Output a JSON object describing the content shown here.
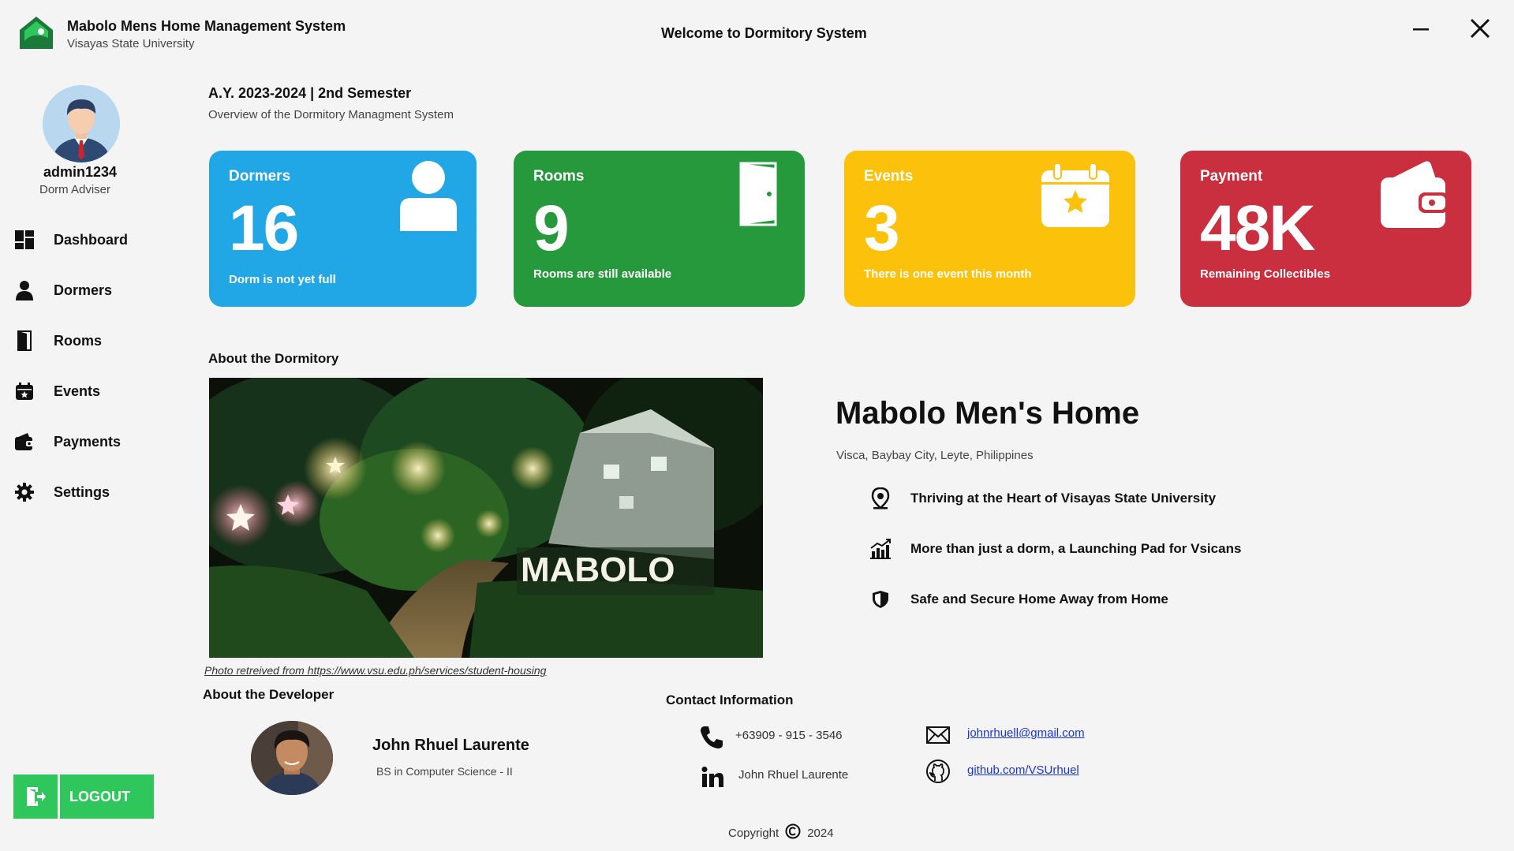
{
  "app": {
    "title": "Mabolo Mens Home Management System",
    "subtitle": "Visayas State University",
    "welcome": "Welcome to Dormitory System"
  },
  "user": {
    "name": "admin1234",
    "role": "Dorm Adviser"
  },
  "nav": [
    {
      "label": "Dashboard",
      "icon": "dashboard-icon"
    },
    {
      "label": "Dormers",
      "icon": "person-icon"
    },
    {
      "label": "Rooms",
      "icon": "door-icon"
    },
    {
      "label": "Events",
      "icon": "calendar-icon"
    },
    {
      "label": "Payments",
      "icon": "wallet-icon"
    },
    {
      "label": "Settings",
      "icon": "gear-icon"
    }
  ],
  "logout_label": "LOGOUT",
  "header": {
    "academic_year": "A.Y. 2023-2024 | 2nd Semester",
    "overview": "Overview of the Dormitory Managment System"
  },
  "cards": [
    {
      "title": "Dormers",
      "value": "16",
      "subtitle": "Dorm is not yet full",
      "color": "#21a7e5",
      "icon": "person-icon"
    },
    {
      "title": "Rooms",
      "value": "9",
      "subtitle": "Rooms are still available",
      "color": "#27993d",
      "icon": "door-icon"
    },
    {
      "title": "Events",
      "value": "3",
      "subtitle": "There is one event this month",
      "color": "#fcc10b",
      "icon": "calendar-star-icon"
    },
    {
      "title": "Payment",
      "value": "48K",
      "subtitle": "Remaining Collectibles",
      "color": "#c92f3f",
      "icon": "wallet-icon"
    }
  ],
  "about": {
    "title": "About the Dormitory",
    "photo_credit": "Photo retreived from https://www.vsu.edu.ph/services/student-housing",
    "photo_sign_text": "MABOLO",
    "dorm_name": "Mabolo Men's Home",
    "location": "Visca, Baybay City, Leyte, Philippines",
    "features": [
      {
        "label": "Thriving at the Heart of Visayas State University",
        "icon": "location-pin-icon"
      },
      {
        "label": "More than just a dorm, a Launching Pad for Vsicans",
        "icon": "growth-chart-icon"
      },
      {
        "label": "Safe and Secure Home Away from Home",
        "icon": "shield-icon"
      }
    ]
  },
  "developer": {
    "title": "About the Developer",
    "name": "John Rhuel Laurente",
    "course": "BS in Computer Science - II"
  },
  "contact": {
    "title": "Contact Information",
    "phone": "+63909 - 915 - 3546",
    "linkedin": "John Rhuel Laurente",
    "email": "johnrhuell@gmail.com",
    "github": "github.com/VSUrhuel"
  },
  "footer": {
    "copyright_label": "Copyright",
    "year": "2024"
  }
}
